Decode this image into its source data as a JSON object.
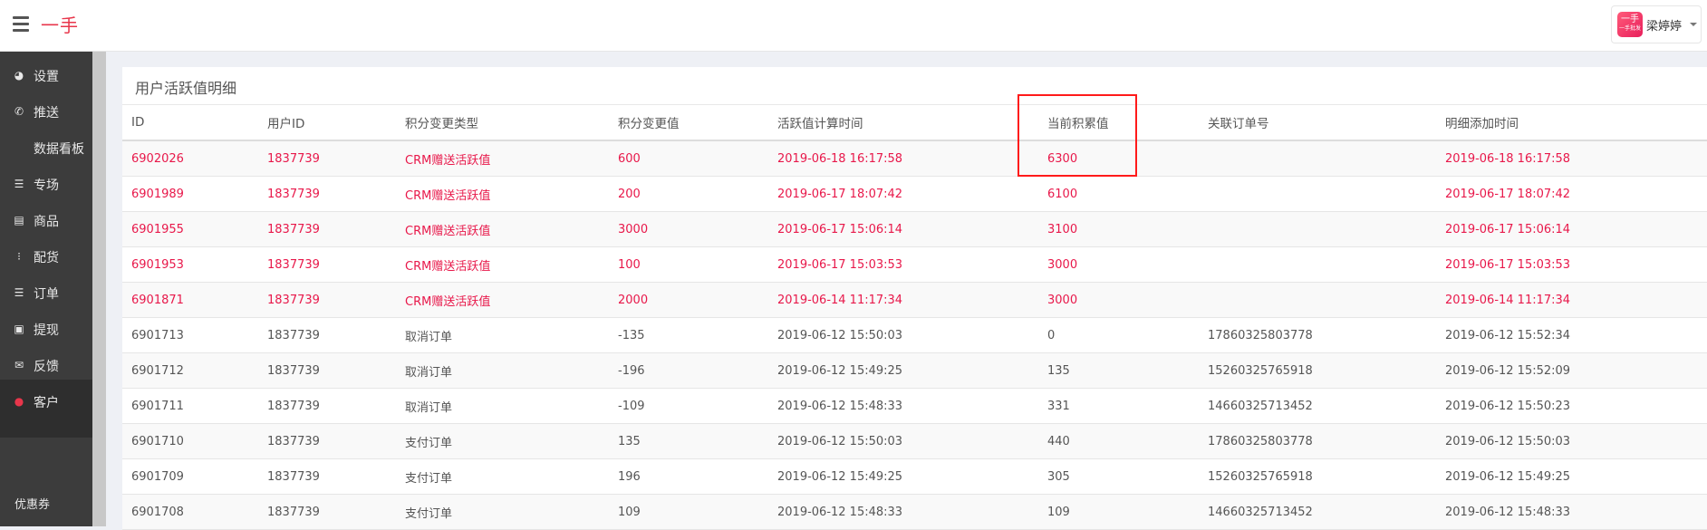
{
  "app": {
    "logo": "一手"
  },
  "user": {
    "avatar_text": "一手",
    "avatar_sub": "一手批发",
    "name": "梁婷婷"
  },
  "sidebar": {
    "items": [
      {
        "label": "设置",
        "icon": "dashboard-icon"
      },
      {
        "label": "推送",
        "icon": "phone-icon"
      },
      {
        "label": "数据看板",
        "icon": ""
      },
      {
        "label": "专场",
        "icon": "list-icon"
      },
      {
        "label": "商品",
        "icon": "card-icon"
      },
      {
        "label": "配货",
        "icon": "list-ordered-icon"
      },
      {
        "label": "订单",
        "icon": "list-icon"
      },
      {
        "label": "提现",
        "icon": "money-icon"
      },
      {
        "label": "反馈",
        "icon": "chat-icon"
      },
      {
        "label": "客户",
        "icon": "user-icon",
        "active": true
      }
    ],
    "sub_items": [
      {
        "label": "优惠券"
      }
    ]
  },
  "panel": {
    "title": "用户活跃值明细"
  },
  "table": {
    "headers": [
      "ID",
      "用户ID",
      "积分变更类型",
      "积分变更值",
      "活跃值计算时间",
      "当前积累值",
      "关联订单号",
      "明细添加时间"
    ],
    "rows": [
      [
        "6902026",
        "1837739",
        "CRM赠送活跃值",
        "600",
        "2019-06-18 16:17:58",
        "6300",
        "",
        "2019-06-18 16:17:58"
      ],
      [
        "6901989",
        "1837739",
        "CRM赠送活跃值",
        "200",
        "2019-06-17 18:07:42",
        "6100",
        "",
        "2019-06-17 18:07:42"
      ],
      [
        "6901955",
        "1837739",
        "CRM赠送活跃值",
        "3000",
        "2019-06-17 15:06:14",
        "3100",
        "",
        "2019-06-17 15:06:14"
      ],
      [
        "6901953",
        "1837739",
        "CRM赠送活跃值",
        "100",
        "2019-06-17 15:03:53",
        "3000",
        "",
        "2019-06-17 15:03:53"
      ],
      [
        "6901871",
        "1837739",
        "CRM赠送活跃值",
        "2000",
        "2019-06-14 11:17:34",
        "3000",
        "",
        "2019-06-14 11:17:34"
      ],
      [
        "6901713",
        "1837739",
        "取消订单",
        "-135",
        "2019-06-12 15:50:03",
        "0",
        "17860325803778",
        "2019-06-12 15:52:34"
      ],
      [
        "6901712",
        "1837739",
        "取消订单",
        "-196",
        "2019-06-12 15:49:25",
        "135",
        "15260325765918",
        "2019-06-12 15:52:09"
      ],
      [
        "6901711",
        "1837739",
        "取消订单",
        "-109",
        "2019-06-12 15:48:33",
        "331",
        "14660325713452",
        "2019-06-12 15:50:23"
      ],
      [
        "6901710",
        "1837739",
        "支付订单",
        "135",
        "2019-06-12 15:50:03",
        "440",
        "17860325803778",
        "2019-06-12 15:50:03"
      ],
      [
        "6901709",
        "1837739",
        "支付订单",
        "196",
        "2019-06-12 15:49:25",
        "305",
        "15260325765918",
        "2019-06-12 15:49:25"
      ],
      [
        "6901708",
        "1837739",
        "支付订单",
        "109",
        "2019-06-12 15:48:33",
        "109",
        "14660325713452",
        "2019-06-12 15:48:33"
      ]
    ],
    "highlight_rows": 5
  },
  "colors": {
    "accent": "#e8364b",
    "highlight_text": "#e8184a",
    "annotation_box": "#ff1a1a",
    "sidebar_bg": "#3c3c3c"
  }
}
